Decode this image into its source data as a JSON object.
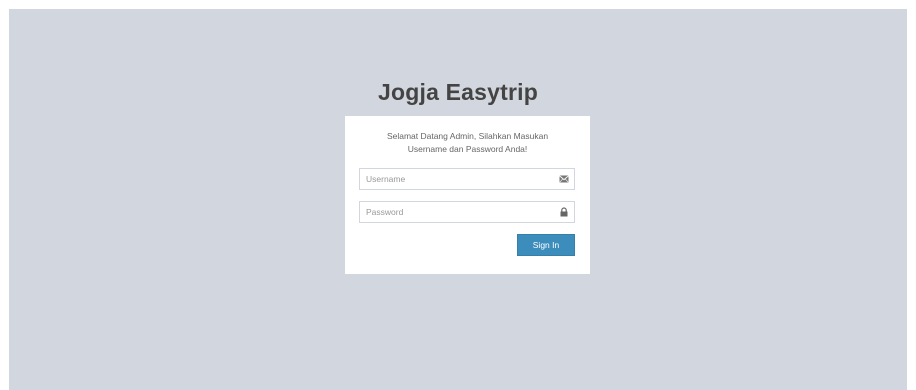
{
  "app": {
    "title": "Jogja Easytrip"
  },
  "login": {
    "message": "Selamat Datang Admin, Silahkan Masukan Username dan Password Anda!",
    "username_placeholder": "Username",
    "username_value": "",
    "username_icon": "envelope-icon",
    "password_placeholder": "Password",
    "password_value": "",
    "password_icon": "lock-icon",
    "signin_label": "Sign In"
  },
  "colors": {
    "background": "#d2d6de",
    "button": "#3c8dbc",
    "title_text": "#444444"
  }
}
